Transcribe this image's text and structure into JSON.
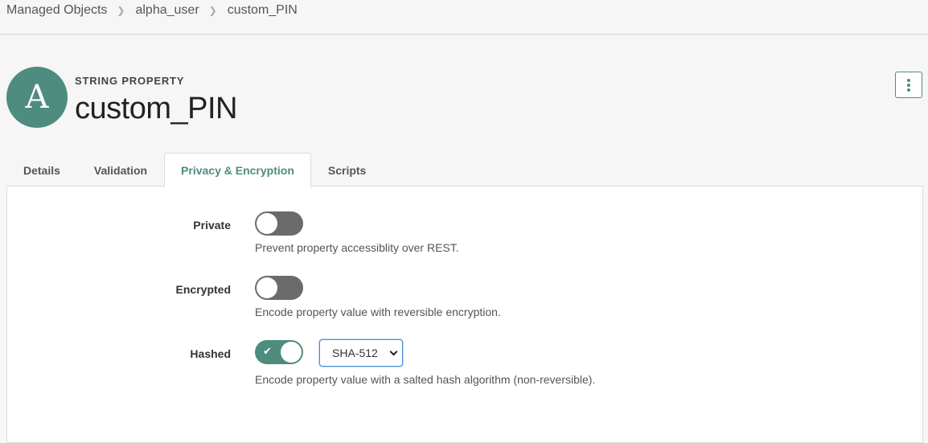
{
  "breadcrumb": [
    "Managed Objects",
    "alpha_user",
    "custom_PIN"
  ],
  "header": {
    "avatar_letter": "A",
    "subtitle": "STRING PROPERTY",
    "title": "custom_PIN"
  },
  "tabs": [
    {
      "label": "Details",
      "active": false
    },
    {
      "label": "Validation",
      "active": false
    },
    {
      "label": "Privacy & Encryption",
      "active": true
    },
    {
      "label": "Scripts",
      "active": false
    }
  ],
  "settings": {
    "private": {
      "label": "Private",
      "enabled": false,
      "help": "Prevent property accessiblity over REST."
    },
    "encrypted": {
      "label": "Encrypted",
      "enabled": false,
      "help": "Encode property value with reversible encryption."
    },
    "hashed": {
      "label": "Hashed",
      "enabled": true,
      "algorithm": "SHA-512",
      "help": "Encode property value with a salted hash algorithm (non-reversible)."
    }
  },
  "colors": {
    "accent": "#4e8c80",
    "toggle_off": "#6b6b6b"
  }
}
